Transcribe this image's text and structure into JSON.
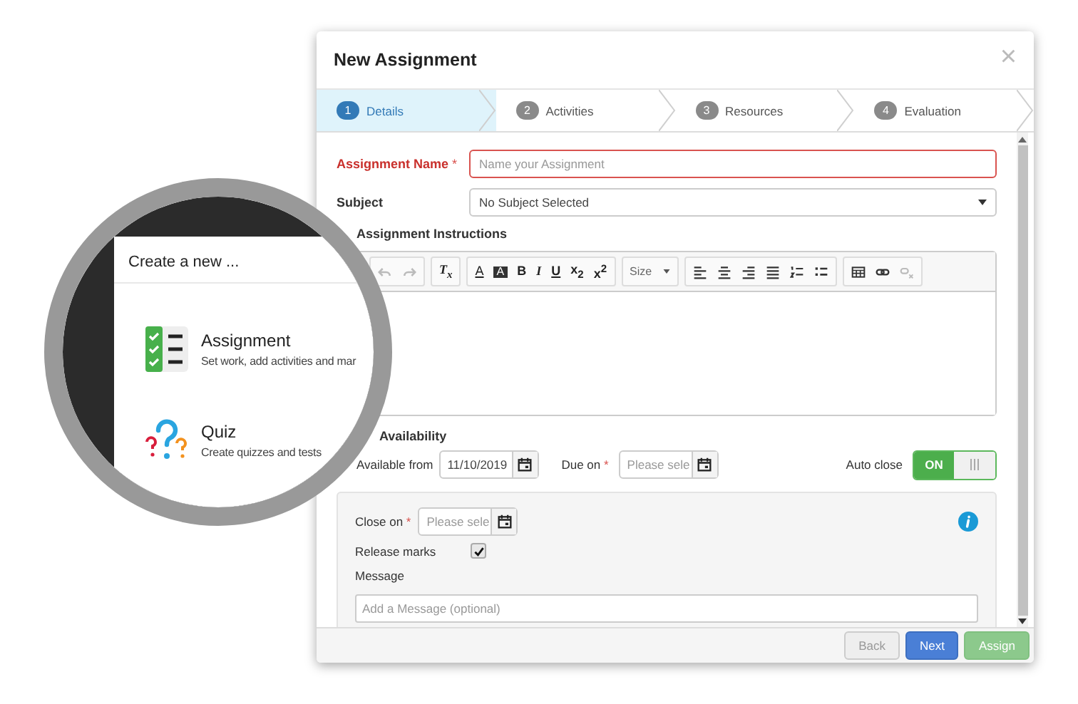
{
  "magnifier": {
    "title": "Create a new ...",
    "items": [
      {
        "kind": "assignment",
        "title": "Assignment",
        "description": "Set work, add activities and mar"
      },
      {
        "kind": "quiz",
        "title": "Quiz",
        "description": "Create quizzes and tests"
      }
    ]
  },
  "dialog": {
    "title": "New Assignment",
    "close": "×",
    "steps": [
      {
        "number": "1",
        "label": "Details",
        "selected": true
      },
      {
        "number": "2",
        "label": "Activities",
        "selected": false
      },
      {
        "number": "3",
        "label": "Resources",
        "selected": false
      },
      {
        "number": "4",
        "label": "Evaluation",
        "selected": false
      }
    ],
    "name_field": {
      "label": "Assignment Name",
      "required_mark": "*",
      "invalid": true,
      "placeholder": "Name your Assignment"
    },
    "subject_field": {
      "label": "Subject",
      "value": "No Subject Selected"
    },
    "instructions_label": "Assignment Instructions",
    "toolbar": {
      "clear_format": "T$_{x}$",
      "font_color": "A",
      "background_color": "A",
      "styles": [
        "B",
        "I",
        "U"
      ],
      "scripts": [
        "x$_{2}$",
        "x$^{2}$"
      ],
      "size": "Size"
    },
    "availability": {
      "heading": "Availability",
      "available_from": {
        "label": "Available from",
        "value": "11/10/2019"
      },
      "due_on": {
        "label": "Due on",
        "required_mark": "*",
        "placeholder": "Please sele"
      },
      "auto_close": {
        "label": "Auto close",
        "on": true,
        "on_text": "ON"
      }
    },
    "close_panel": {
      "close_on": {
        "label": "Close on",
        "required_mark": "*",
        "placeholder": "Please sele"
      },
      "release_marks": {
        "label": "Release marks",
        "checked": true
      },
      "message": {
        "label": "Message",
        "placeholder": "Add a Message (optional)"
      }
    },
    "buttons": [
      {
        "kind": "default",
        "label": "Back",
        "disabled": true
      },
      {
        "kind": "primary",
        "label": "Next",
        "disabled": false
      },
      {
        "kind": "success",
        "label": "Assign",
        "disabled": true
      }
    ]
  }
}
